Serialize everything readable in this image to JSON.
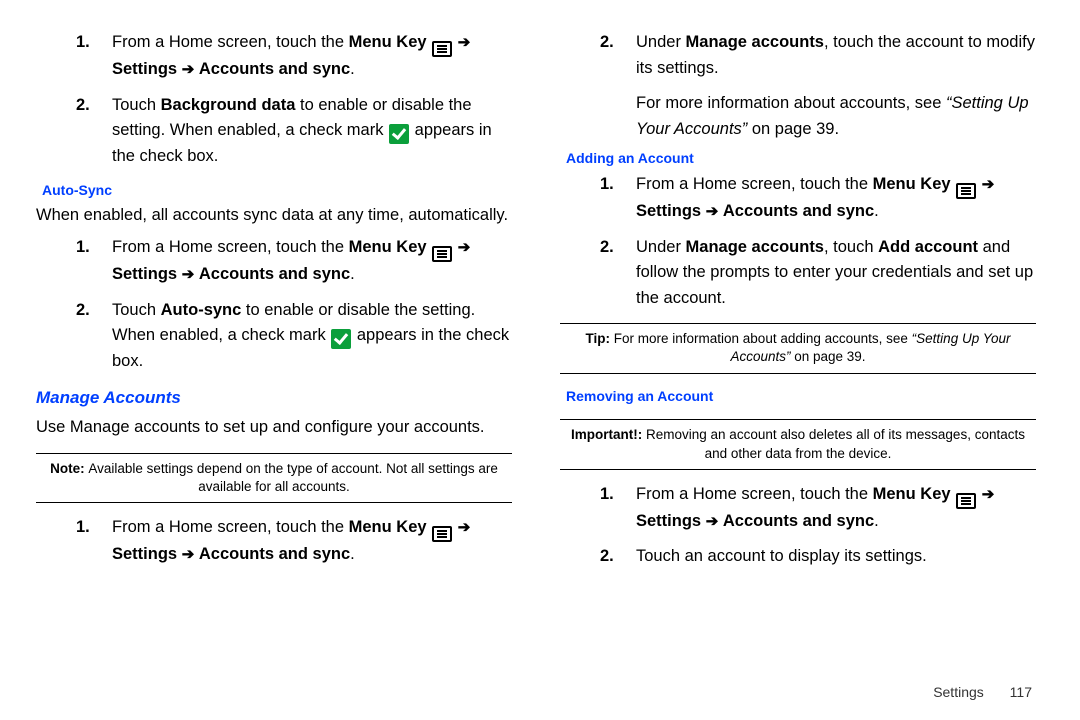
{
  "left": {
    "list1": {
      "n1": "1.",
      "i1a": "From a Home screen, touch the ",
      "i1b": "Menu Key",
      "i1c": "Settings",
      "i1d": "Accounts and sync",
      "i1e": ".",
      "n2": "2.",
      "i2a": "Touch ",
      "i2b": "Background data",
      "i2c": " to enable or disable the setting. When enabled, a check mark ",
      "i2d": " appears in the check box."
    },
    "h_autosync": "Auto-Sync",
    "autosync_desc": "When enabled, all accounts sync data at any time, automatically.",
    "list2": {
      "n1": "1.",
      "i1a": "From a Home screen, touch the ",
      "i1b": "Menu Key",
      "i1c": "Settings",
      "i1d": "Accounts and sync",
      "i1e": ".",
      "n2": "2.",
      "i2a": "Touch ",
      "i2b": "Auto-sync",
      "i2c": " to enable or disable the setting. When enabled, a check mark ",
      "i2d": " appears in the check box."
    },
    "h_manage": "Manage Accounts",
    "manage_desc": "Use Manage accounts to set up and configure your accounts.",
    "note_label": "Note: ",
    "note_text": "Available settings depend on the type of account. Not all settings are available for all accounts.",
    "list3": {
      "n1": "1.",
      "i1a": "From a Home screen, touch the ",
      "i1b": "Menu Key",
      "i1c": "Settings",
      "i1d": "Accounts and sync",
      "i1e": "."
    }
  },
  "right": {
    "list1": {
      "n2": "2.",
      "i2a": "Under ",
      "i2b": "Manage accounts",
      "i2c": ", touch the account to modify its settings."
    },
    "more_a": "For more information about accounts, see ",
    "more_b": "“Setting Up Your Accounts”",
    "more_c": " on page 39.",
    "h_adding": "Adding an Account",
    "list2": {
      "n1": "1.",
      "i1a": "From a Home screen, touch the ",
      "i1b": "Menu Key",
      "i1c": "Settings",
      "i1d": "Accounts and sync",
      "i1e": ".",
      "n2": "2.",
      "i2a": "Under ",
      "i2b": "Manage accounts",
      "i2c": ", touch ",
      "i2d": "Add account",
      "i2e": " and follow the prompts to enter your credentials and set up the account."
    },
    "tip_label": "Tip: ",
    "tip_a": "For more information about adding accounts, see ",
    "tip_b": "“Setting Up Your Accounts”",
    "tip_c": " on page 39.",
    "h_removing": "Removing an Account",
    "imp_label": "Important!: ",
    "imp_text": "Removing an account also deletes all of its messages, contacts and other data from the device.",
    "list3": {
      "n1": "1.",
      "i1a": "From a Home screen, touch the ",
      "i1b": "Menu Key",
      "i1c": "Settings",
      "i1d": "Accounts and sync",
      "i1e": ".",
      "n2": "2.",
      "i2": "Touch an account to display its settings."
    }
  },
  "arrow": "➔",
  "footer": {
    "section": "Settings",
    "page": "117"
  }
}
